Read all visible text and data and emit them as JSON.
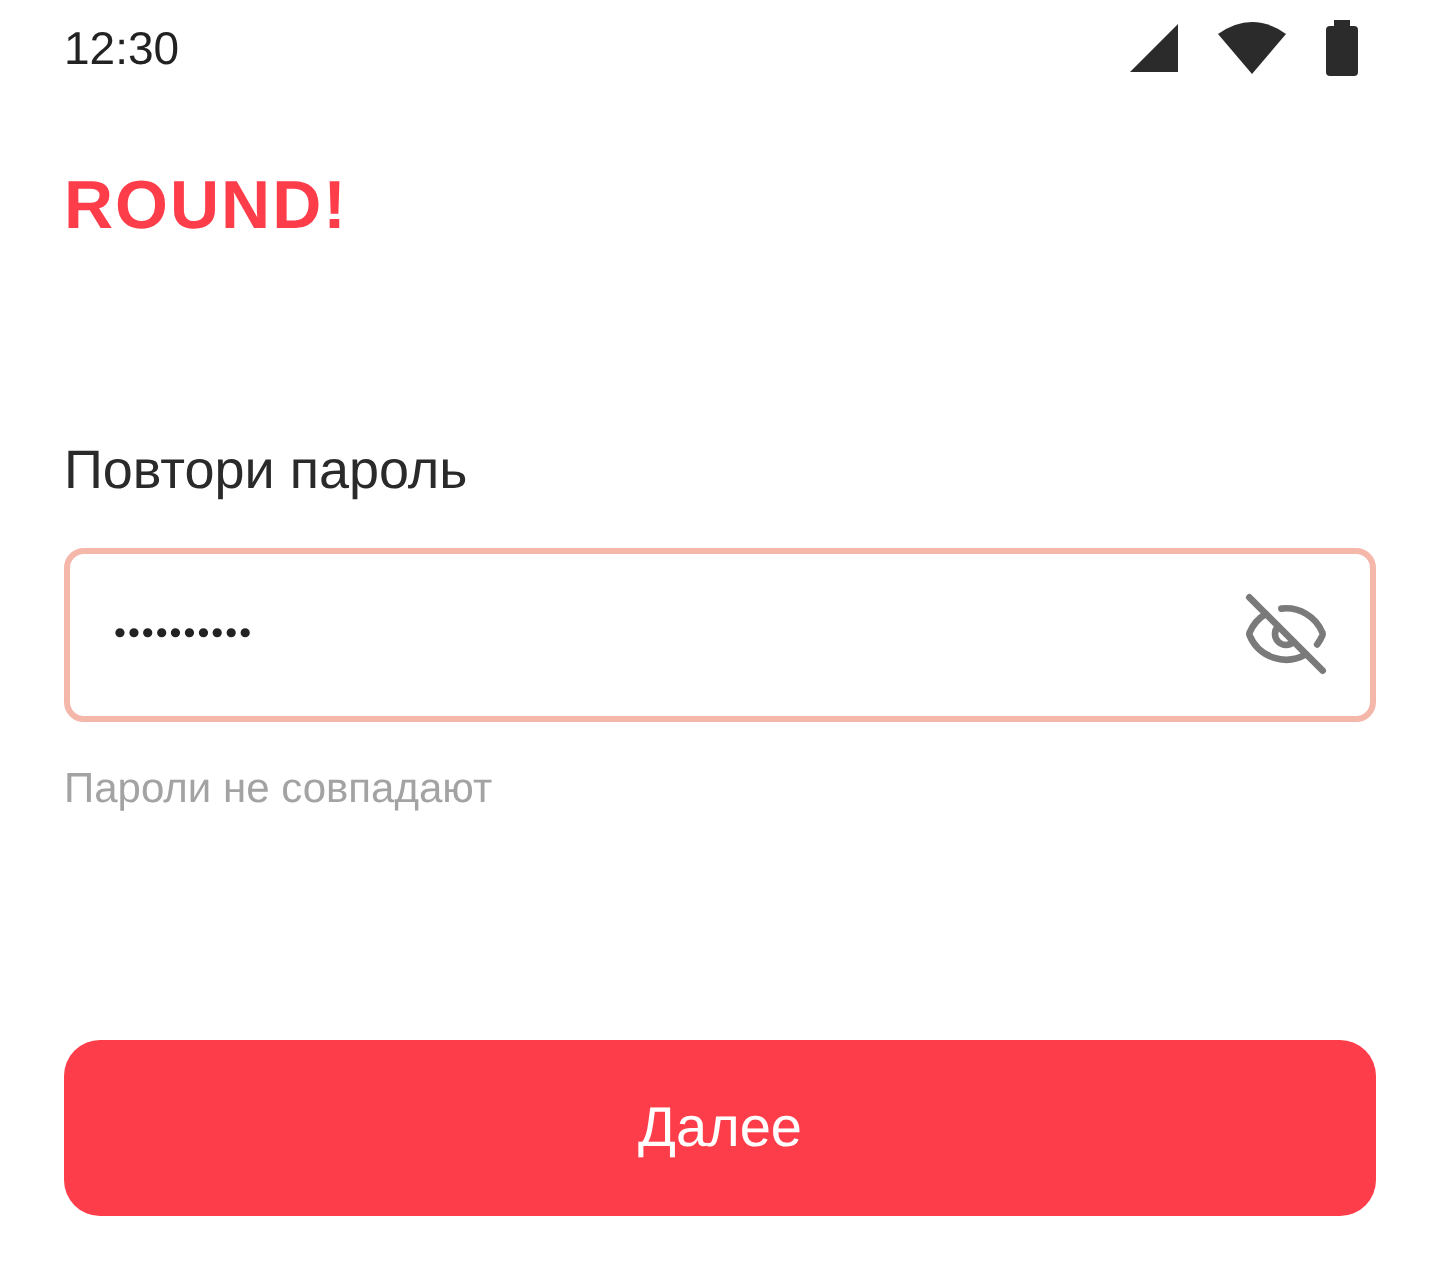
{
  "status_bar": {
    "time": "12:30"
  },
  "logo": "ROUND!",
  "password_field": {
    "label": "Повтори пароль",
    "value": "••••••••••",
    "error": true,
    "password_visible": false,
    "hint": "Пароли не совпадают"
  },
  "button": {
    "label": "Далее"
  }
}
